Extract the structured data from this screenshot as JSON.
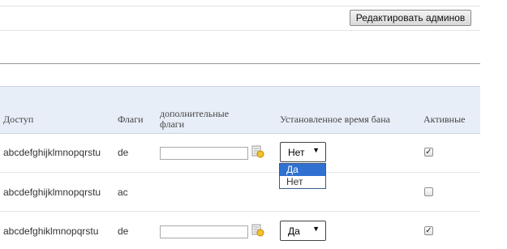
{
  "toolbar": {
    "edit_admins_label": "Редактировать админов"
  },
  "table": {
    "headers": {
      "access": "Доступ",
      "flags": "Флаги",
      "extra_flags_line1": "дополнительные",
      "extra_flags_line2": "флаги",
      "ban_time": "Установленное время бана",
      "active": "Активные"
    },
    "rows": [
      {
        "access": "abcdefghijklmnopqrstu",
        "flags": "de",
        "ban_time_value": "Нет",
        "active": true
      },
      {
        "access": "abcdefghijklmnopqrstu",
        "flags": "ac",
        "active": false
      },
      {
        "access": "abcdefghiklmnopqrstu",
        "flags": "de",
        "ban_time_value": "Да",
        "active": true
      }
    ]
  },
  "dropdown": {
    "options": [
      "Да",
      "Нет"
    ],
    "highlighted": "Да"
  }
}
